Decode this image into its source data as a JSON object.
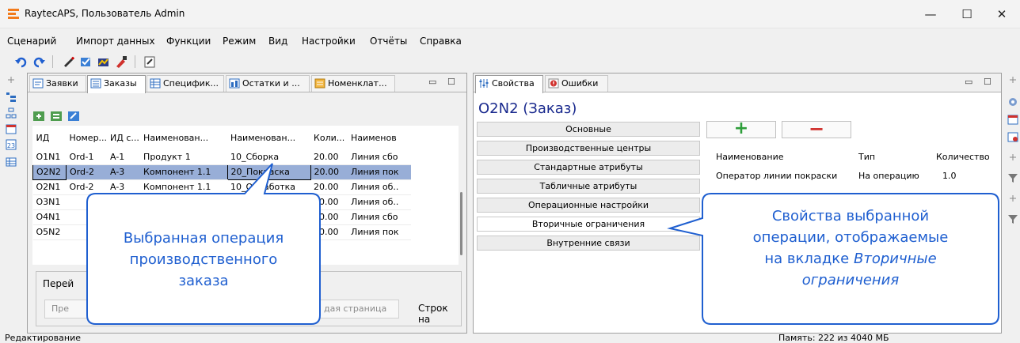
{
  "window": {
    "title": "RaytecAPS, Пользователь Admin",
    "controls": {
      "minimize": "—",
      "maximize": "☐",
      "close": "✕"
    }
  },
  "menu": [
    "Сценарий",
    "Импорт данных",
    "Функции",
    "Режим",
    "Вид",
    "Настройки",
    "Отчёты",
    "Справка"
  ],
  "left_panel": {
    "tabs": [
      "Заявки",
      "Заказы",
      "Специфик...",
      "Остатки и ...",
      "Номенклат..."
    ],
    "active_tab": "Заказы",
    "panel_controls": {
      "pin": "▭",
      "max": "☐"
    },
    "grid": {
      "columns": [
        "ИД",
        "Номер...",
        "ИД с...",
        "Наименован...",
        "Наименован...",
        "Коли...",
        "Наименов"
      ],
      "rows": [
        [
          "O1N1",
          "Ord-1",
          "A-1",
          "Продукт 1",
          "10_Сборка",
          "20.00",
          "Линия сбо"
        ],
        [
          "O2N2",
          "Ord-2",
          "A-3",
          "Компонент 1.1",
          "20_Покраска",
          "20.00",
          "Линия пок"
        ],
        [
          "O2N1",
          "Ord-2",
          "A-3",
          "Компонент 1.1",
          "10_Обработка",
          "20.00",
          "Линия об.."
        ],
        [
          "O3N1",
          "",
          "",
          "",
          "а",
          "60.00",
          "Линия об.."
        ],
        [
          "O4N1",
          "",
          "",
          "",
          "",
          "10.00",
          "Линия сбо"
        ],
        [
          "O5N2",
          "",
          "",
          "",
          "",
          "40.00",
          "Линия пок"
        ]
      ],
      "selected_row": 1
    },
    "pager": {
      "title": "Перей",
      "prev": "Пре",
      "last": "дая страница",
      "rows_label": "Строк на"
    }
  },
  "right_panel": {
    "tabs": [
      "Свойства",
      "Ошибки"
    ],
    "active_tab": "Свойства",
    "panel_controls": {
      "pin": "▭",
      "max": "☐"
    },
    "object_title": "O2N2 (Заказ)",
    "categories": [
      "Основные",
      "Производственные центры",
      "Стандартные атрибуты",
      "Табличные атрибуты",
      "Операционные настройки",
      "Вторичные ограничения",
      "Внутренние связи"
    ],
    "active_category": "Вторичные ограничения",
    "buttons": {
      "add": "+",
      "remove": "−"
    },
    "table": {
      "columns": [
        "Наименование",
        "Тип",
        "Количество"
      ],
      "rows": [
        [
          "Оператор линии покраски",
          "На операцию",
          "1.0"
        ]
      ]
    }
  },
  "status": {
    "left": "Редактирование",
    "memory": "Память: 222 из 4040 МБ"
  },
  "callouts": {
    "left": [
      "Выбранная операция",
      "производственного",
      "заказа"
    ],
    "right_line1": "Свойства выбранной",
    "right_line2": "операции, отображаемые",
    "right_line3": "на вкладке",
    "right_italic1": "Вторичные",
    "right_italic2": "ограничения"
  },
  "colors": {
    "accent_title": "#1a2a8e",
    "callout": "#1f5fd0",
    "selection": "#98aed7",
    "add_green": "#2e9e3a",
    "remove_red": "#d0312d",
    "app_orange": "#f27b1c"
  }
}
